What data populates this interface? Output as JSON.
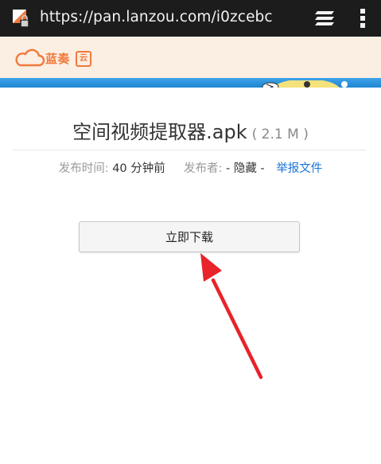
{
  "browser": {
    "url": "https://pan.lanzou.com/i0zcebc",
    "icons": [
      "favicon-lock-icon",
      "tabs-icon",
      "overflow-menu-icon"
    ]
  },
  "site": {
    "logo_text": "蓝奏",
    "logo_badge": "云"
  },
  "file": {
    "name": "空间视频提取器.apk",
    "size": "( 2.1 M )",
    "meta": {
      "time_label": "发布时间:",
      "time_value": "40 分钟前",
      "publisher_label": "发布者:",
      "publisher_value": "- 隐藏 -",
      "report_link": "举报文件"
    }
  },
  "download_button": "立即下载",
  "colors": {
    "url_bar": "#1c1c1c",
    "header_bg": "#fbeee3",
    "brand_orange": "#f07a3c",
    "link_blue": "#1a73d9",
    "arrow_red": "#e8232a"
  }
}
